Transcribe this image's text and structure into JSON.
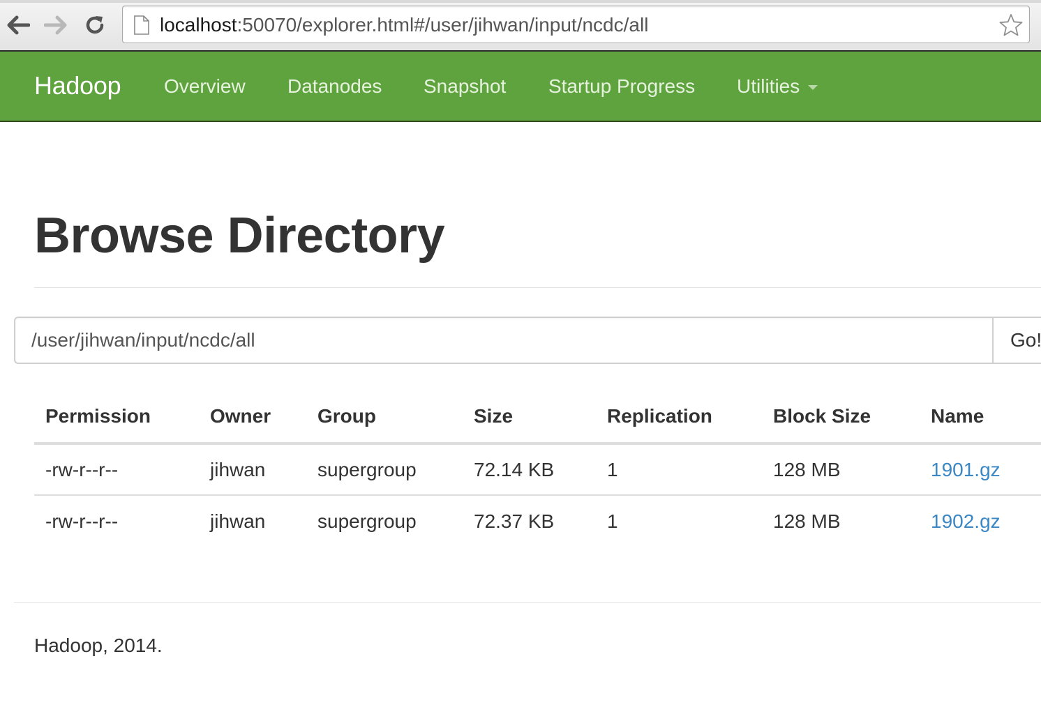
{
  "browser": {
    "url_host": "localhost",
    "url_rest": ":50070/explorer.html#/user/jihwan/input/ncdc/all",
    "icons": [
      "back-arrow-icon",
      "forward-arrow-icon",
      "reload-icon",
      "page-icon",
      "star-icon"
    ]
  },
  "navbar": {
    "brand": "Hadoop",
    "items": [
      "Overview",
      "Datanodes",
      "Snapshot",
      "Startup Progress",
      "Utilities"
    ],
    "color": "#5fa33e"
  },
  "page": {
    "title": "Browse Directory"
  },
  "path_bar": {
    "value": "/user/jihwan/input/ncdc/all",
    "go_label": "Go!"
  },
  "table": {
    "columns": [
      "Permission",
      "Owner",
      "Group",
      "Size",
      "Replication",
      "Block Size",
      "Name"
    ],
    "rows": [
      [
        "-rw-r--r--",
        "jihwan",
        "supergroup",
        "72.14 KB",
        "1",
        "128 MB",
        "1901.gz"
      ],
      [
        "-rw-r--r--",
        "jihwan",
        "supergroup",
        "72.37 KB",
        "1",
        "128 MB",
        "1902.gz"
      ]
    ],
    "link_color": "#3b87c4"
  },
  "footer": {
    "text": "Hadoop, 2014."
  }
}
